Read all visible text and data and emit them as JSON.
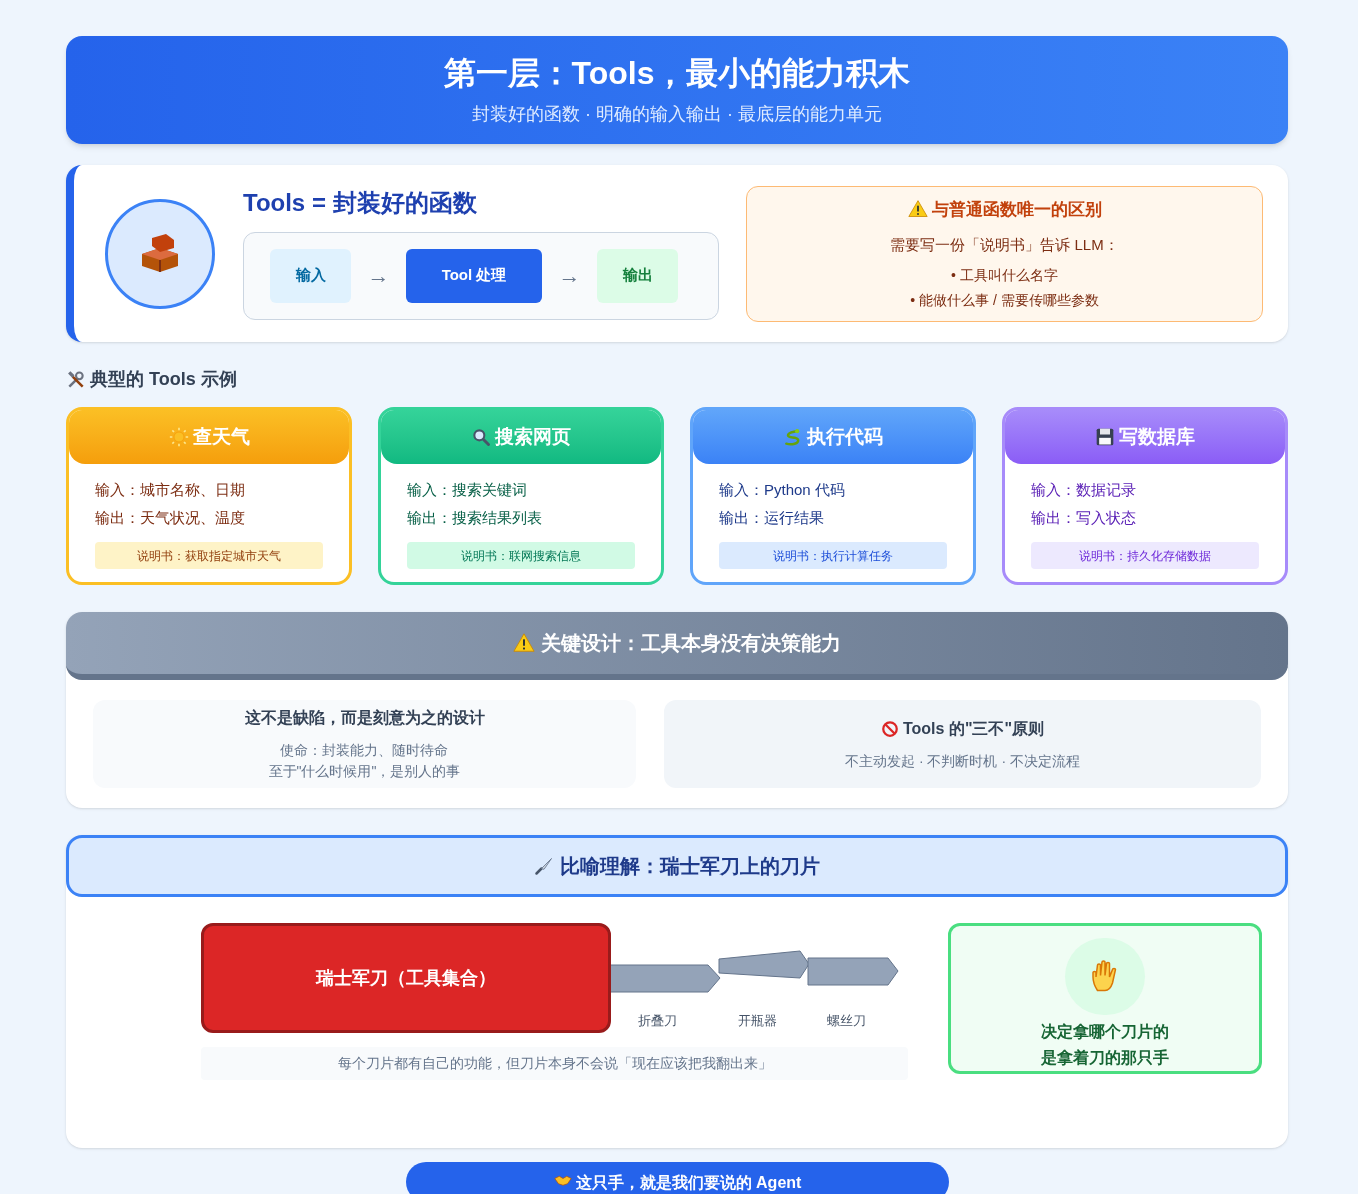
{
  "header": {
    "title": "第一层：Tools，最小的能力积木",
    "subtitle": "封装好的函数 · 明确的输入输出 · 最底层的能力单元"
  },
  "definition": {
    "title": "Tools = 封装好的函数",
    "flow": [
      {
        "kind": "input",
        "label": "输入"
      },
      {
        "kind": "process",
        "label": "Tool 处理"
      },
      {
        "kind": "output",
        "label": "输出"
      }
    ],
    "arrows": [
      "→",
      "→"
    ],
    "note": {
      "title": "与普通函数唯一的区别",
      "text": "需要写一份「说明书」告诉 LLM：",
      "bullets": [
        "• 工具叫什么名字",
        "• 能做什么事 / 需要传哪些参数"
      ]
    }
  },
  "examples_heading": "典型的 Tools 示例",
  "examples": [
    {
      "kind": "weather",
      "title": "查天气",
      "input": "输入：城市名称、日期",
      "output": "输出：天气状况、温度",
      "manual": "说明书：获取指定城市天气"
    },
    {
      "kind": "search",
      "title": "搜索网页",
      "input": "输入：搜索关键词",
      "output": "输出：搜索结果列表",
      "manual": "说明书：联网搜索信息"
    },
    {
      "kind": "code",
      "title": "执行代码",
      "input": "输入：Python 代码",
      "output": "输出：运行结果",
      "manual": "说明书：执行计算任务"
    },
    {
      "kind": "database",
      "title": "写数据库",
      "input": "输入：数据记录",
      "output": "输出：写入状态",
      "manual": "说明书：持久化存储数据"
    }
  ],
  "key_design": {
    "title": "关键设计：工具本身没有决策能力",
    "panels": [
      {
        "kind": "plain",
        "title": "这不是缺陷，而是刻意为之的设计",
        "lines": [
          "使命：封装能力、随时待命",
          "至于\"什么时候用\"，是别人的事"
        ]
      },
      {
        "kind": "rule",
        "title": "Tools 的\"三不\"原则",
        "lines": [
          "不主动发起 · 不判断时机 · 不决定流程"
        ]
      }
    ]
  },
  "analogy": {
    "title": "比喻理解：瑞士军刀上的刀片",
    "knife": "瑞士军刀（工具集合）",
    "blades": [
      "折叠刀",
      "开瓶器",
      "螺丝刀"
    ],
    "caption": "每个刀片都有自己的功能，但刀片本身不会说「现在应该把我翻出来」",
    "hand_lines": [
      "决定拿哪个刀片的",
      "是拿着刀的那只手"
    ]
  },
  "footer": "这只手，就是我们要说的 Agent"
}
